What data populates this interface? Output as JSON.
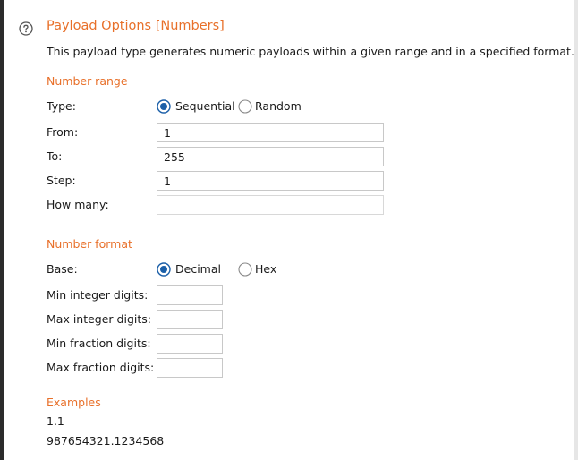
{
  "header": {
    "title": "Payload Options [Numbers]",
    "description": "This payload type generates numeric payloads within a given range and in a specified format."
  },
  "number_range": {
    "section_title": "Number range",
    "type_label": "Type:",
    "type_options": [
      "Sequential",
      "Random"
    ],
    "type_selected": "Sequential",
    "from_label": "From:",
    "from_value": "1",
    "to_label": "To:",
    "to_value": "255",
    "step_label": "Step:",
    "step_value": "1",
    "how_many_label": "How many:",
    "how_many_value": ""
  },
  "number_format": {
    "section_title": "Number format",
    "base_label": "Base:",
    "base_options": [
      "Decimal",
      "Hex"
    ],
    "base_selected": "Decimal",
    "min_integer_label": "Min integer digits:",
    "min_integer_value": "",
    "max_integer_label": "Max integer digits:",
    "max_integer_value": "",
    "min_fraction_label": "Min fraction digits:",
    "min_fraction_value": "",
    "max_fraction_label": "Max fraction digits:",
    "max_fraction_value": ""
  },
  "examples": {
    "section_title": "Examples",
    "items": [
      "1.1",
      "987654321.1234568"
    ]
  },
  "colors": {
    "accent": "#e8702a",
    "radio_selected": "#1b5fa8"
  },
  "icons": {
    "help": "help-icon"
  }
}
